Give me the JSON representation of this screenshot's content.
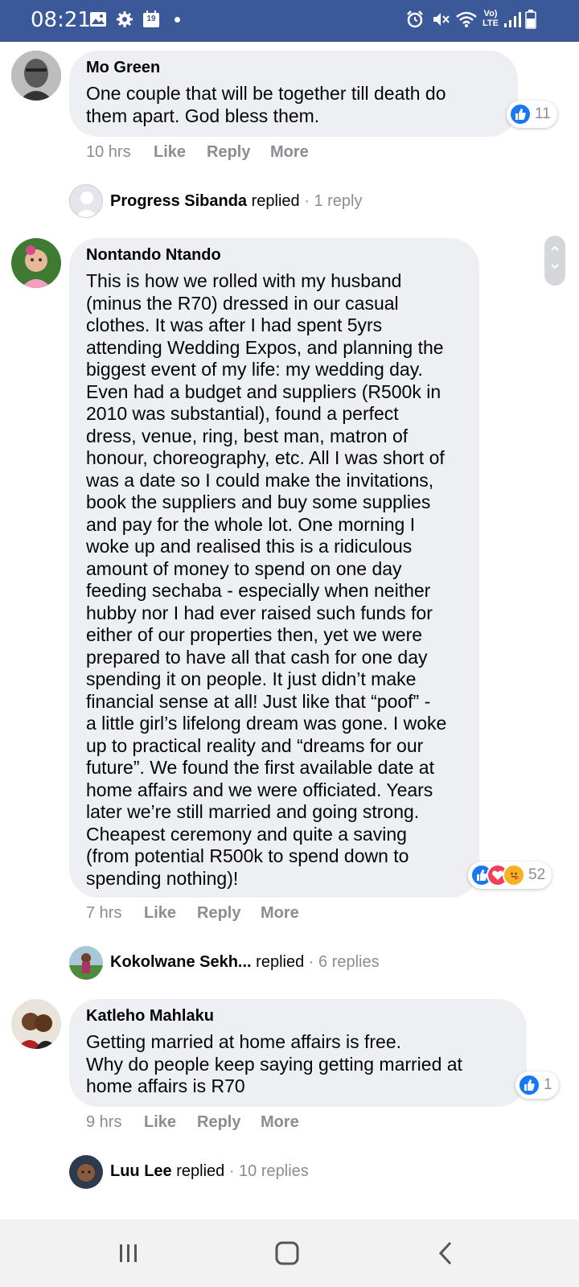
{
  "status_bar": {
    "time": "08:21",
    "calendar_day": "19",
    "network_label_top": "Vo)",
    "network_label_bottom": "LTE",
    "background": "#3b5998"
  },
  "comments": [
    {
      "author": "Mo Green",
      "text": "One couple that will be together till death do\nthem apart. God bless them.",
      "time": "10 hrs",
      "like_label": "Like",
      "reply_label": "Reply",
      "more_label": "More",
      "reaction_count": "11",
      "reactions": [
        "like"
      ],
      "replies": {
        "name": "Progress Sibanda",
        "verb": "replied",
        "count": "· 1 reply"
      }
    },
    {
      "author": "Nontando Ntando",
      "text": "This is how we rolled with my husband\n(minus the R70) dressed in our casual\nclothes. It was after I had spent 5yrs\nattending Wedding Expos, and planning the\nbiggest event of my life: my wedding day.\nEven had a budget and suppliers (R500k in\n2010 was substantial), found a perfect\ndress, venue, ring, best man, matron of\nhonour, choreography, etc. All I was short of\nwas a date so I could make the invitations,\nbook the suppliers and buy some supplies\nand pay for the whole lot. One morning I\nwoke up and realised this is a ridiculous\namount of money to spend on one day\nfeeding sechaba - especially when neither\nhubby nor I had ever raised such funds for\neither of our properties then, yet we were\nprepared to have all that cash for one day\nspending it on people. It just didn’t make\nfinancial sense at all! Just like that “poof” -\na little girl’s lifelong dream was gone. I woke\nup to practical reality and “dreams for our\nfuture”. We found the first available date at\nhome affairs and we were officiated. Years\nlater we’re still married and going strong.\nCheapest ceremony and quite a saving\n(from potential R500k to spend down to\nspending nothing)!",
      "time": "7 hrs",
      "like_label": "Like",
      "reply_label": "Reply",
      "more_label": "More",
      "reaction_count": "52",
      "reactions": [
        "like",
        "love",
        "care"
      ],
      "replies": {
        "name": "Kokolwane Sekh...",
        "verb": "replied",
        "count": "· 6 replies"
      }
    },
    {
      "author": "Katleho Mahlaku",
      "text": "Getting married at home affairs is free.\nWhy do people keep saying getting married at\nhome affairs is R70",
      "time": "9 hrs",
      "like_label": "Like",
      "reply_label": "Reply",
      "more_label": "More",
      "reaction_count": "1",
      "reactions": [
        "like"
      ],
      "replies": {
        "name": "Luu Lee",
        "verb": "replied",
        "count": "· 10 replies"
      }
    }
  ],
  "colors": {
    "bubble": "#eeeff2",
    "muted_text": "#8a8d91",
    "like_blue": "#1877f2",
    "love_red": "#f33e58",
    "care_yellow": "#f7b125"
  },
  "nav_bar": {
    "icons": [
      "recent-apps-icon",
      "home-icon",
      "back-icon"
    ]
  }
}
